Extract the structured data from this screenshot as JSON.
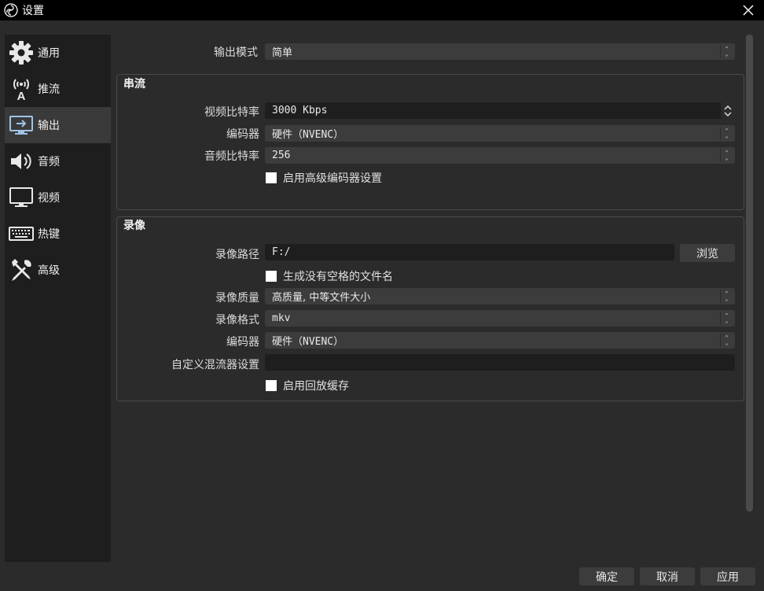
{
  "window": {
    "title": "设置"
  },
  "sidebar": {
    "items": [
      {
        "label": "通用",
        "icon": "gear-icon"
      },
      {
        "label": "推流",
        "icon": "broadcast-icon"
      },
      {
        "label": "输出",
        "icon": "output-monitor-icon",
        "active": true
      },
      {
        "label": "音频",
        "icon": "speaker-icon"
      },
      {
        "label": "视频",
        "icon": "monitor-icon"
      },
      {
        "label": "热键",
        "icon": "keyboard-icon"
      },
      {
        "label": "高级",
        "icon": "tools-icon"
      }
    ]
  },
  "output": {
    "mode_label": "输出模式",
    "mode_value": "简单"
  },
  "streaming": {
    "title": "串流",
    "video_bitrate_label": "视频比特率",
    "video_bitrate_value": "3000 Kbps",
    "encoder_label": "编码器",
    "encoder_value": "硬件（NVENC）",
    "audio_bitrate_label": "音频比特率",
    "audio_bitrate_value": "256",
    "advanced_encoder_label": "启用高级编码器设置"
  },
  "recording": {
    "title": "录像",
    "path_label": "录像路径",
    "path_value": "F:/",
    "browse_label": "浏览",
    "no_space_label": "生成没有空格的文件名",
    "quality_label": "录像质量",
    "quality_value": "高质量, 中等文件大小",
    "format_label": "录像格式",
    "format_value": "mkv",
    "encoder_label": "编码器",
    "encoder_value": "硬件（NVENC）",
    "muxer_label": "自定义混流器设置",
    "muxer_value": "",
    "replay_buffer_label": "启用回放缓存"
  },
  "footer": {
    "ok_label": "确定",
    "cancel_label": "取消",
    "apply_label": "应用"
  },
  "colors": {
    "background": "#2b2b2b",
    "sidebar": "#1e1e1e",
    "field": "#3c3c3c",
    "field_dark": "#1e1e1e",
    "titlebar": "#000000"
  }
}
